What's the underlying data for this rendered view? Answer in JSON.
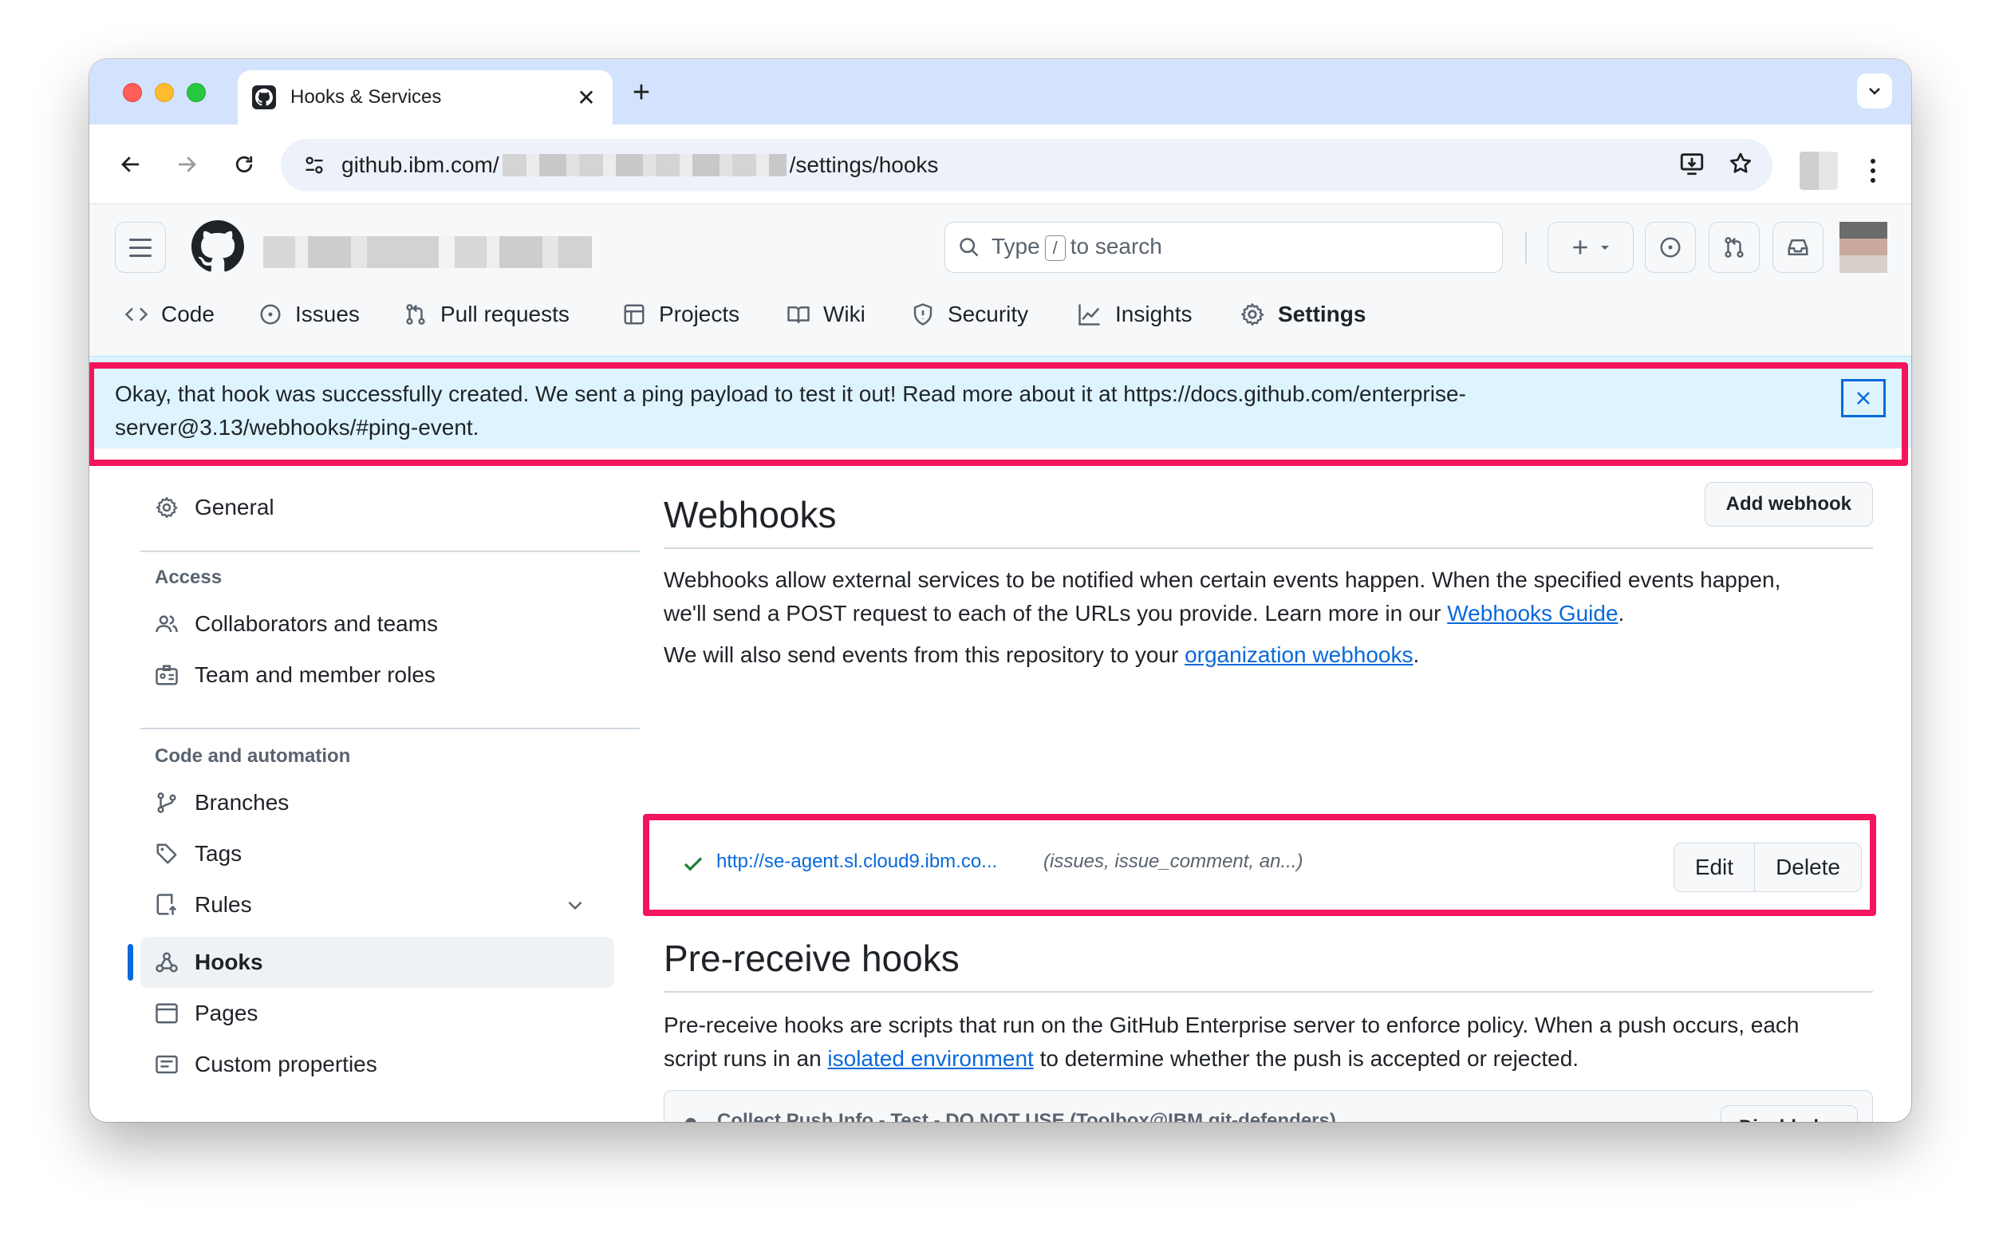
{
  "browser": {
    "tab_title": "Hooks & Services",
    "url_host": "github.ibm.com/",
    "url_path": "/settings/hooks"
  },
  "header": {
    "search_prefix": "Type",
    "search_key": "/",
    "search_suffix": "to search"
  },
  "repo_nav": [
    {
      "label": "Code",
      "icon": "code-icon"
    },
    {
      "label": "Issues",
      "icon": "issue-opened-icon"
    },
    {
      "label": "Pull requests",
      "icon": "git-pull-request-icon"
    },
    {
      "label": "Projects",
      "icon": "table-icon"
    },
    {
      "label": "Wiki",
      "icon": "book-icon"
    },
    {
      "label": "Security",
      "icon": "shield-icon"
    },
    {
      "label": "Insights",
      "icon": "graph-icon"
    },
    {
      "label": "Settings",
      "icon": "gear-icon",
      "active": true
    }
  ],
  "flash": {
    "line1": "Okay, that hook was successfully created. We sent a ping payload to test it out! Read more about it at https://docs.github.com/enterprise-",
    "line2": "server@3.13/webhooks/#ping-event."
  },
  "sidebar": {
    "general": "General",
    "access_heading": "Access",
    "collaborators": "Collaborators and teams",
    "team_roles": "Team and member roles",
    "code_heading": "Code and automation",
    "branches": "Branches",
    "tags": "Tags",
    "rules": "Rules",
    "hooks": "Hooks",
    "pages": "Pages",
    "custom_properties": "Custom properties"
  },
  "webhooks": {
    "title": "Webhooks",
    "add_button": "Add webhook",
    "desc_line1": "Webhooks allow external services to be notified when certain events happen. When the specified events happen,",
    "desc_line2_prefix": "we'll send a POST request to each of the URLs you provide. Learn more in our ",
    "guide_link": "Webhooks Guide",
    "desc_line2_suffix": ".",
    "org_prefix": "We will also send events from this repository to your ",
    "org_link": "organization webhooks",
    "org_suffix": ".",
    "hook": {
      "url": "http://se-agent.sl.cloud9.ibm.co...",
      "events": "(issues, issue_comment, an...)",
      "edit": "Edit",
      "delete": "Delete"
    }
  },
  "prereceive": {
    "title": "Pre-receive hooks",
    "desc_line1": "Pre-receive hooks are scripts that run on the GitHub Enterprise server to enforce policy. When a push occurs, each",
    "desc_line2_prefix": "script runs in an ",
    "env_link": "isolated environment",
    "desc_line2_suffix": " to determine whether the push is accepted or rejected.",
    "hook_name": "Collect Push Info - Test - DO NOT USE (Toolbox@IBM git-defenders)",
    "state": "Disabled"
  },
  "colors": {
    "highlight": "#f4155d",
    "link": "#0969da",
    "flash_bg": "#ddf4ff",
    "success": "#1a7f37"
  }
}
